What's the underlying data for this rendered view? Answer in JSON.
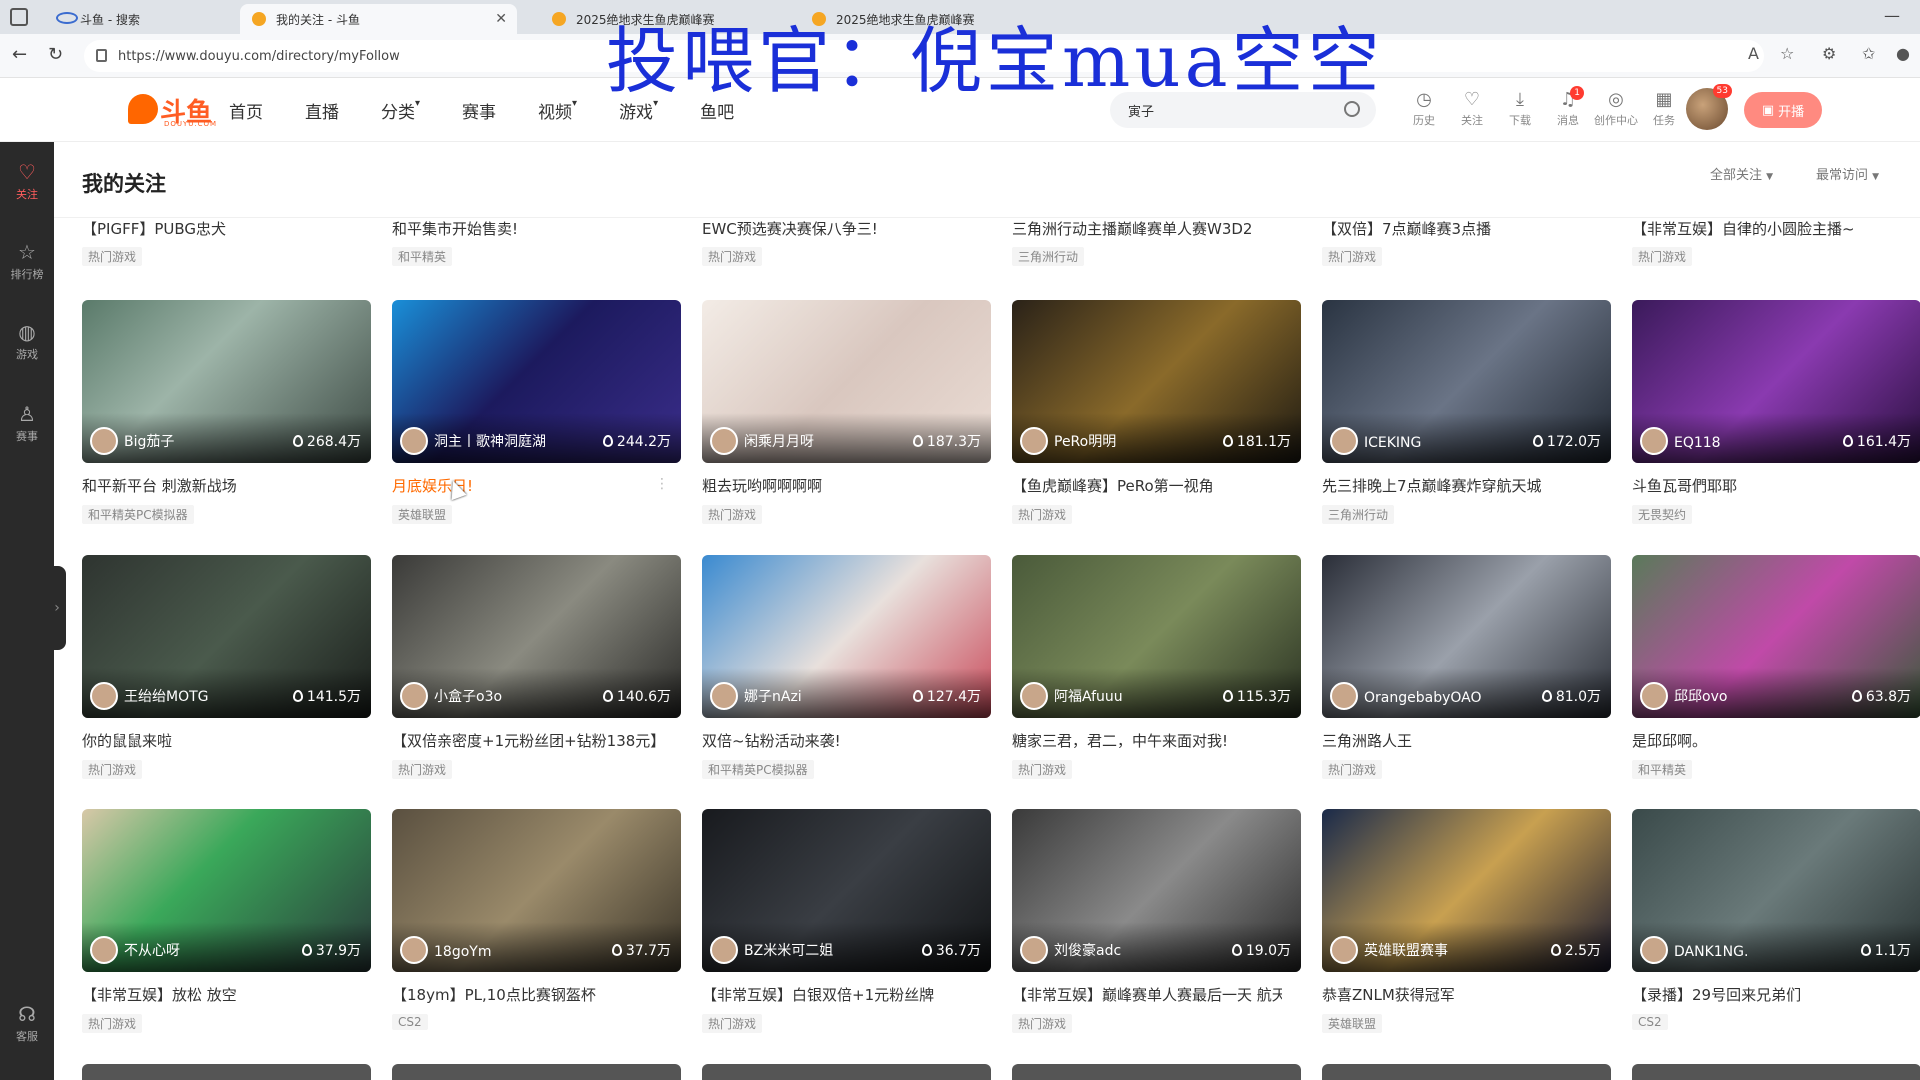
{
  "browser": {
    "tabs": [
      {
        "title": "斗鱼 - 搜索",
        "active": false
      },
      {
        "title": "我的关注 - 斗鱼",
        "active": true
      },
      {
        "title": "2025绝地求生鱼虎巅峰赛",
        "active": false
      },
      {
        "title": "2025绝地求生鱼虎巅峰赛",
        "active": false
      }
    ],
    "url": "https://www.douyu.com/directory/myFollow"
  },
  "watermark": "投喂官：倪宝mua空空",
  "header": {
    "logo_text": "斗鱼",
    "logo_sub": "DOUYU.COM",
    "nav": [
      {
        "label": "首页",
        "caret": false
      },
      {
        "label": "直播",
        "caret": false
      },
      {
        "label": "分类",
        "caret": true
      },
      {
        "label": "赛事",
        "caret": false
      },
      {
        "label": "视频",
        "caret": true
      },
      {
        "label": "游戏",
        "caret": true
      },
      {
        "label": "鱼吧",
        "caret": false
      }
    ],
    "search_value": "寅子",
    "icons": [
      {
        "label": "历史",
        "icon": "clock-icon",
        "badge": ""
      },
      {
        "label": "关注",
        "icon": "heart-icon",
        "badge": ""
      },
      {
        "label": "下载",
        "icon": "download-icon",
        "badge": ""
      },
      {
        "label": "消息",
        "icon": "bell-icon",
        "badge": "1"
      },
      {
        "label": "创作中心",
        "icon": "lightbulb-icon",
        "badge": ""
      },
      {
        "label": "任务",
        "icon": "gift-icon",
        "badge": ""
      }
    ],
    "avatar_badge": "53",
    "open_live": "开播"
  },
  "sidebar": [
    {
      "label": "关注",
      "icon": "heart-icon",
      "active": true
    },
    {
      "label": "排行榜",
      "icon": "rank-icon",
      "active": false
    },
    {
      "label": "游戏",
      "icon": "gamepad-icon",
      "active": false
    },
    {
      "label": "赛事",
      "icon": "trophy-icon",
      "active": false
    },
    {
      "label": "客服",
      "icon": "headset-icon",
      "active": false
    }
  ],
  "page": {
    "title": "我的关注",
    "filter_all": "全部关注",
    "sort_recent": "最常访问"
  },
  "top_partial_row": [
    {
      "title": "【PIGFF】PUBG忠犬",
      "tag": "热门游戏"
    },
    {
      "title": "和平集市开始售卖!",
      "tag": "和平精英"
    },
    {
      "title": "EWC预选赛决赛保八争三!",
      "tag": "热门游戏"
    },
    {
      "title": "三角洲行动主播巅峰赛单人赛W3D2",
      "tag": "三角洲行动"
    },
    {
      "title": "【双倍】7点巅峰赛3点播",
      "tag": "热门游戏"
    },
    {
      "title": "【非常互娱】自律的小圆脸主播~",
      "tag": "热门游戏"
    }
  ],
  "cards": [
    {
      "streamer": "Big茄子",
      "viewers": "268.4万",
      "title": "和平新平台 刺激新战场",
      "tag": "和平精英PC模拟器",
      "bg": "linear-gradient(135deg,#5a7a6a,#9db4a8 40%,#3d4a44)"
    },
    {
      "streamer": "洞主丨歌神洞庭湖",
      "viewers": "244.2万",
      "title": "月底娱乐日!",
      "tag": "英雄联盟",
      "bg": "linear-gradient(135deg,#1a8fd8,#1c1a5e 45%,#3a2d8a)",
      "hover": true
    },
    {
      "streamer": "闲乘月月呀",
      "viewers": "187.3万",
      "title": "粗去玩哟啊啊啊啊",
      "tag": "热门游戏",
      "bg": "linear-gradient(135deg,#f3ece6,#d9c7bf 50%,#eadcd4)"
    },
    {
      "streamer": "PeRo明明",
      "viewers": "181.1万",
      "title": "【鱼虎巅峰赛】PeRo第一视角",
      "tag": "热门游戏",
      "bg": "linear-gradient(135deg,#2a2218,#8a6a2a 50%,#1e1a12)"
    },
    {
      "streamer": "ICEKING",
      "viewers": "172.0万",
      "title": "先三排晚上7点巅峰赛炸穿航天城",
      "tag": "三角洲行动",
      "bg": "linear-gradient(135deg,#2a3442,#6a7486 50%,#1f2630)"
    },
    {
      "streamer": "EQ118",
      "viewers": "161.4万",
      "title": "斗鱼瓦哥們耶耶",
      "tag": "无畏契约",
      "bg": "linear-gradient(135deg,#3a1a5a,#8a3ab0 50%,#2a1040)"
    },
    {
      "streamer": "王绐绐MOTG",
      "viewers": "141.5万",
      "title": "你的鼠鼠来啦",
      "tag": "热门游戏",
      "bg": "linear-gradient(135deg,#2e3430,#4a5a4c 50%,#1a1e1b)"
    },
    {
      "streamer": "小盒子o3o",
      "viewers": "140.6万",
      "title": "【双倍亲密度+1元粉丝团+钻粉138元】",
      "tag": "热门游戏",
      "bg": "linear-gradient(135deg,#3a3a38,#8a8a80 50%,#2a2a28)"
    },
    {
      "streamer": "娜子nAzi",
      "viewers": "127.4万",
      "title": "双倍~钻粉活动来袭!",
      "tag": "和平精英PC模拟器",
      "bg": "linear-gradient(135deg,#3a8ad0,#e8e0dc 50%,#c94a5a)"
    },
    {
      "streamer": "阿福Afuuu",
      "viewers": "115.3万",
      "title": "糖家三君，君二，中午来面对我!",
      "tag": "热门游戏",
      "bg": "linear-gradient(135deg,#4a5a3a,#7a8a5a 50%,#2a3222)"
    },
    {
      "streamer": "OrangebabyOAO",
      "viewers": "81.0万",
      "title": "三角洲路人王",
      "tag": "热门游戏",
      "bg": "linear-gradient(135deg,#2a2e38,#9aa0aa 50%,#2a2e36)"
    },
    {
      "streamer": "邱邱ovo",
      "viewers": "63.8万",
      "title": "是邱邱啊。",
      "tag": "和平精英",
      "bg": "linear-gradient(135deg,#5a7a5a,#c04aa8 50%,#3a5a3a)"
    },
    {
      "streamer": "不从心呀",
      "viewers": "37.9万",
      "title": "【非常互娱】放松 放空",
      "tag": "热门游戏",
      "bg": "linear-gradient(135deg,#d8c8a8,#3aa85a 40%,#2a3a3a)"
    },
    {
      "streamer": "18goYm",
      "viewers": "37.7万",
      "title": "【18ym】PL,10点比赛钢盔杯",
      "tag": "CS2",
      "bg": "linear-gradient(135deg,#5a5040,#9a8a6a 50%,#3a3428)"
    },
    {
      "streamer": "BZ米米可二姐",
      "viewers": "36.7万",
      "title": "【非常互娱】白银双倍+1元粉丝牌",
      "tag": "热门游戏",
      "bg": "linear-gradient(135deg,#181a1e,#3a3e44 50%,#121416)"
    },
    {
      "streamer": "刘俊豪adc",
      "viewers": "19.0万",
      "title": "【非常互娱】巅峰赛单人赛最后一天 航天!",
      "tag": "热门游戏",
      "bg": "linear-gradient(135deg,#3a3a3a,#8a8a8a 50%,#2a2a2a)"
    },
    {
      "streamer": "英雄联盟赛事",
      "viewers": "2.5万",
      "title": "恭喜ZNLM获得冠军",
      "tag": "英雄联盟",
      "bg": "linear-gradient(135deg,#1a2a4a,#c8a050 50%,#1a1a30)"
    },
    {
      "streamer": "DANK1NG.",
      "viewers": "1.1万",
      "title": "【录播】29号回来兄弟们",
      "tag": "CS2",
      "bg": "linear-gradient(135deg,#3a4a4a,#6a7a7a 50%,#2a3434)"
    }
  ]
}
